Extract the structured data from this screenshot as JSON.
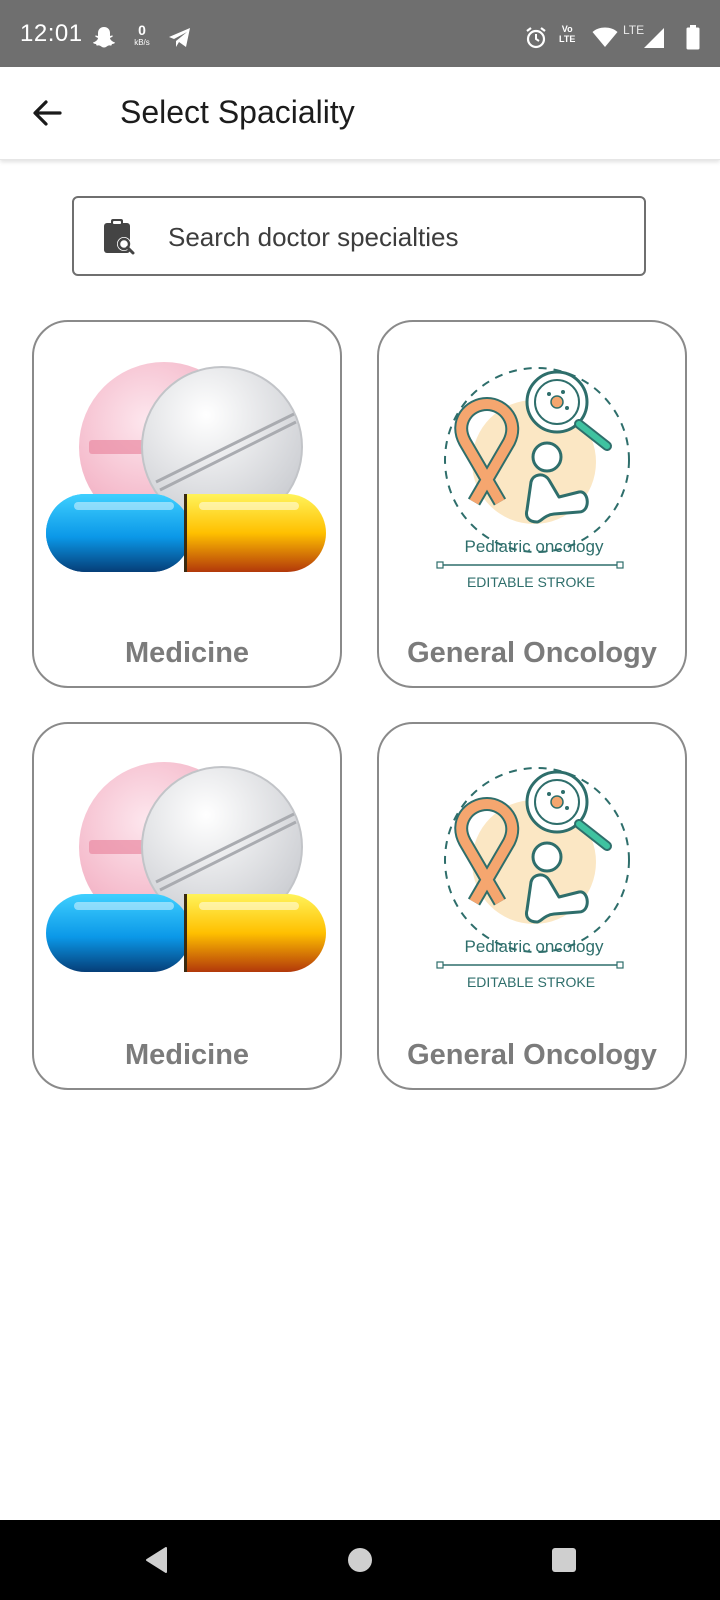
{
  "status_bar": {
    "time": "12:01",
    "net_speed_value": "0",
    "net_speed_unit": "kB/s",
    "volte_top": "Vo",
    "volte_bottom": "LTE",
    "lte_label": "LTE",
    "icons": [
      "snapchat-icon",
      "telegram-icon",
      "alarm-icon",
      "volte-icon",
      "wifi-icon",
      "signal-icon",
      "battery-icon"
    ]
  },
  "app_bar": {
    "title": "Select Spaciality",
    "back_icon": "arrow-left-icon"
  },
  "search": {
    "placeholder": "Search doctor specialties",
    "value": "",
    "icon": "clipboard-search-icon"
  },
  "specialties": [
    {
      "label": "Medicine",
      "image": "pills-capsule"
    },
    {
      "label": "General Oncology",
      "image": "pediatric-oncology",
      "image_text": "Pediatric oncology",
      "image_subtext": "EDITABLE STROKE"
    },
    {
      "label": "Medicine",
      "image": "pills-capsule"
    },
    {
      "label": "General Oncology",
      "image": "pediatric-oncology",
      "image_text": "Pediatric oncology",
      "image_subtext": "EDITABLE STROKE"
    }
  ],
  "nav_bar": {
    "buttons": [
      "back-triangle-icon",
      "home-circle-icon",
      "recents-square-icon"
    ]
  },
  "colors": {
    "status_bar_bg": "#6f6f6f",
    "card_border": "#8a8a8a",
    "card_label": "#7b7b7b",
    "ribbon": "#f5a66f",
    "teal_outline": "#2e6e6b",
    "accent_green": "#3fc2a0"
  }
}
